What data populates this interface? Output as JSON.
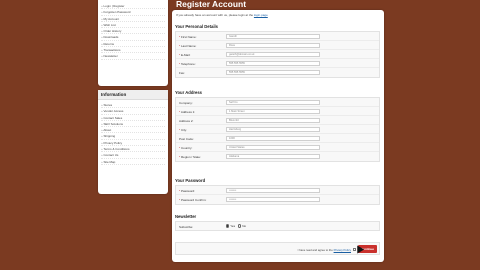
{
  "account_box": {
    "items": [
      "Login | Register",
      "Forgotten Password",
      "My Account",
      "Wish List",
      "Order History",
      "Downloads",
      "Returns",
      "Transactions",
      "Newsletter"
    ]
  },
  "info_box": {
    "title": "Information",
    "items": [
      "Stores",
      "Vendor Access",
      "Contact Sales",
      "SEO Solutions",
      "About",
      "Shipping",
      "Privacy Policy",
      "Terms & Conditions",
      "Contact Us",
      "Site Map"
    ]
  },
  "page": {
    "title": "Register Account",
    "intro_text": "If you already have an account with us, please login at the",
    "intro_link": "login page"
  },
  "personal": {
    "heading": "Your Personal Details",
    "fields": [
      {
        "label": "First Name:",
        "value": "Gareth"
      },
      {
        "label": "Last Name:",
        "value": "Ross"
      },
      {
        "label": "E-Mail:",
        "value": "gareth@domain.co.uk"
      },
      {
        "label": "Telephone:",
        "value": "555 555 5555"
      },
      {
        "label": "Fax:",
        "value": "555 555 5555"
      }
    ]
  },
  "address": {
    "heading": "Your Address",
    "fields": [
      {
        "label": "Company:",
        "value": "Self Co"
      },
      {
        "label": "Address 1:",
        "value": "1 Main Street"
      },
      {
        "label": "Address 2:",
        "value": "Bloomfd"
      },
      {
        "label": "City:",
        "value": "Harrisburg"
      },
      {
        "label": "Post Code:",
        "value": "1000"
      },
      {
        "label": "Country:",
        "value": "United States"
      },
      {
        "label": "Region / State:",
        "value": "Alabama"
      }
    ]
  },
  "password": {
    "heading": "Your Password",
    "fields": [
      {
        "label": "Password:",
        "value": "••••••••"
      },
      {
        "label": "Password Confirm:",
        "value": "••••••••"
      }
    ]
  },
  "newsletter": {
    "heading": "Newsletter",
    "label": "Subscribe:",
    "yes": "Yes",
    "no": "No"
  },
  "footer": {
    "agree_text": "I have read and agree to the",
    "agree_link": "Privacy Policy",
    "continue": "Continue"
  }
}
